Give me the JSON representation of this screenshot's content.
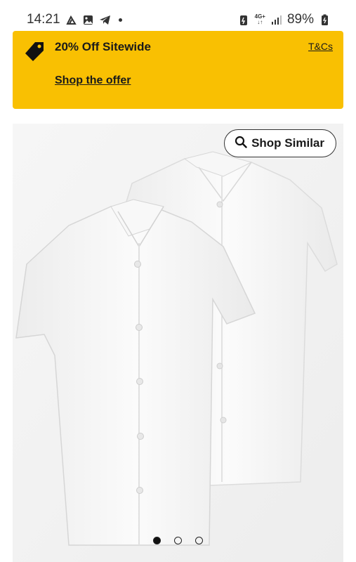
{
  "status_bar": {
    "time": "14:21",
    "battery": "89%",
    "network_top": "4G+",
    "network_bottom": "↓↑",
    "icons": [
      "hanger-icon",
      "gallery-icon",
      "telegram-icon",
      "notification-dot",
      "battery-saver-icon",
      "signal-icon",
      "battery-icon"
    ]
  },
  "promo": {
    "title": "20% Off Sitewide",
    "terms_label": "T&Cs",
    "cta_label": "Shop the offer",
    "background_color": "#f9c002",
    "icon": "price-tag-icon"
  },
  "gallery": {
    "shop_similar_label": "Shop Similar",
    "search_icon": "search-icon",
    "image_description": "Two white short-sleeve school shirts",
    "pagination": {
      "total": 3,
      "active": 1
    }
  }
}
